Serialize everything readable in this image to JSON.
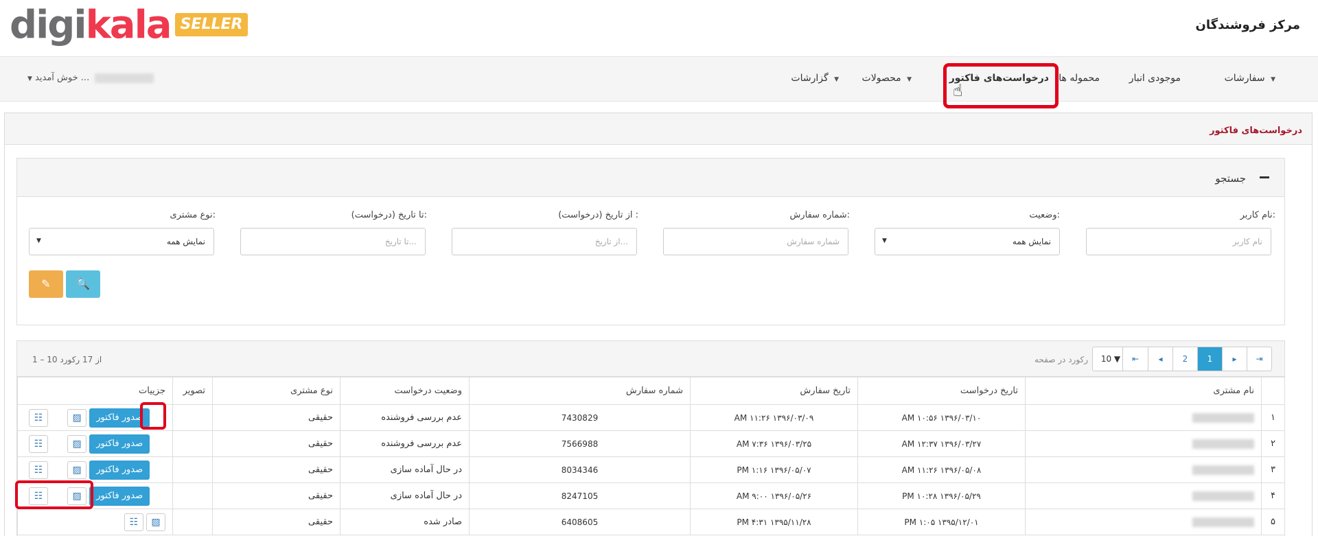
{
  "brand": {
    "logo_part1": "digi",
    "logo_part2": "kala",
    "logo_badge": "SELLER",
    "seller_center": "مرکز فروشندگان"
  },
  "nav": {
    "items": [
      {
        "label": "سفارشات",
        "caret": "▼"
      },
      {
        "label": "موجودی انبار",
        "caret": ""
      },
      {
        "label": "محموله ها",
        "caret": ""
      },
      {
        "label": "درخواست‌های فاکتور",
        "caret": ""
      },
      {
        "label": "محصولات",
        "caret": "▼"
      },
      {
        "label": "گزارشات",
        "caret": "▼"
      }
    ],
    "welcome": "خوش آمدید ...",
    "welcome_caret": "▼"
  },
  "page": {
    "title": "درخواست‌های فاکتور"
  },
  "search": {
    "title": "جستجو",
    "fields": {
      "username": {
        "label": "نام کاربر:",
        "placeholder": "نام کاربر"
      },
      "status": {
        "label": "وضعیت:",
        "value": "نمایش همه",
        "arrow": "▼"
      },
      "order_number": {
        "label": "شماره سفارش:",
        "placeholder": "شماره سفارش"
      },
      "from_date": {
        "label": "از تاریخ (درخواست) :",
        "placeholder": "از تاریخ..."
      },
      "to_date": {
        "label": "تا تاریخ (درخواست):",
        "placeholder": "تا تاریخ..."
      },
      "customer_type": {
        "label": "نوع مشتری:",
        "value": "نمایش همه",
        "arrow": "▼"
      }
    },
    "search_button_icon": "🔍",
    "clear_button_icon": "✎"
  },
  "results": {
    "count_text": "1 – 10 از 17 رکورد",
    "per_page_value": "10 ▼",
    "per_page_label": "رکورد در صفحه",
    "pager": [
      "⇤",
      "◂",
      "2",
      "1",
      "▸",
      "⇥"
    ],
    "columns": {
      "index": "",
      "customer_name": "نام مشتری",
      "request_date": "تاریخ درخواست",
      "order_date": "تاریخ سفارش",
      "order_number": "شماره سفارش",
      "request_status": "وضعیت درخواست",
      "customer_type": "نوع مشتری",
      "image": "تصویر",
      "details": "جزییات"
    },
    "rows": [
      {
        "index": "۱",
        "request_date": "AM ۱۰:۵۶ ۱۳۹۶/۰۳/۱۰",
        "order_date": "AM ۱۱:۲۶ ۱۳۹۶/۰۳/۰۹",
        "order_number": "7430829",
        "status": "عدم بررسی فروشنده",
        "type": "حقیقی",
        "invoice": "صدور فاکتور"
      },
      {
        "index": "۲",
        "request_date": "AM ۱۲:۳۷ ۱۳۹۶/۰۳/۲۷",
        "order_date": "AM ۷:۳۶ ۱۳۹۶/۰۳/۲۵",
        "order_number": "7566988",
        "status": "عدم بررسی فروشنده",
        "type": "حقیقی",
        "invoice": "صدور فاکتور"
      },
      {
        "index": "۳",
        "request_date": "AM ۱۱:۲۶ ۱۳۹۶/۰۵/۰۸",
        "order_date": "PM ۱:۱۶ ۱۳۹۶/۰۵/۰۷",
        "order_number": "8034346",
        "status": "در حال آماده سازی",
        "type": "حقیقی",
        "invoice": "صدور فاکتور"
      },
      {
        "index": "۴",
        "request_date": "PM ۱۰:۲۸ ۱۳۹۶/۰۵/۲۹",
        "order_date": "AM ۹:۰۰ ۱۳۹۶/۰۵/۲۶",
        "order_number": "8247105",
        "status": "در حال آماده سازی",
        "type": "حقیقی",
        "invoice": "صدور فاکتور"
      },
      {
        "index": "۵",
        "request_date": "PM ۱:۰۵ ۱۳۹۵/۱۲/۰۱",
        "order_date": "PM ۴:۳۱ ۱۳۹۵/۱۱/۲۸",
        "order_number": "6408605",
        "status": "صادر شده",
        "type": "حقیقی",
        "invoice": ""
      }
    ]
  },
  "colors": {
    "highlight": "#e1001c",
    "primary_button": "#5bc0de",
    "warning_button": "#f0ad4e",
    "invoice_button": "#33a0d6"
  }
}
